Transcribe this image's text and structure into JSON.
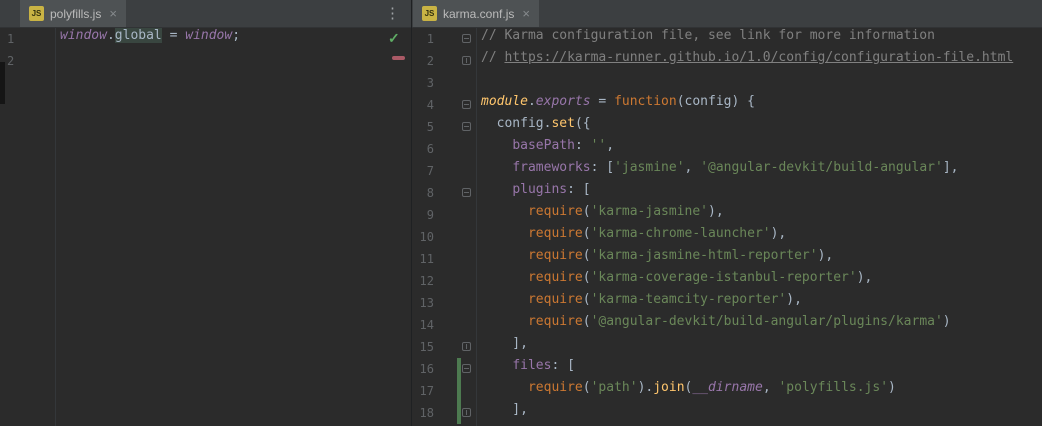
{
  "colors": {
    "background": "#2b2b2b",
    "tab_bar": "#3c3f41",
    "tab_active": "#4e5254",
    "line_number": "#606366",
    "plain_text": "#a9b7c6",
    "comment": "#808080",
    "keyword": "#cc7832",
    "string": "#6a8759",
    "function_call": "#ffc66d",
    "field": "#9876aa",
    "vcs_added_bar": "#4d7a50",
    "modified_marker": "#aa5a66",
    "inspection_ok": "#5fad65"
  },
  "left_pane": {
    "tab": {
      "icon_text": "JS",
      "label": "polyfills.js",
      "close_glyph": "×"
    },
    "more_icon_glyph": "⋮",
    "ok_glyph": "✓",
    "editor": {
      "lines": [
        {
          "num": "1",
          "seg": [
            {
              "c": "g",
              "t": "window"
            },
            {
              "c": "p",
              "t": "."
            },
            {
              "c": "h",
              "t": "global"
            },
            {
              "c": "p",
              "t": " = "
            },
            {
              "c": "g",
              "t": "window"
            },
            {
              "c": "p",
              "t": ";"
            }
          ]
        },
        {
          "num": "2",
          "seg": []
        }
      ]
    }
  },
  "right_pane": {
    "tab": {
      "icon_text": "JS",
      "label": "karma.conf.js",
      "close_glyph": "×"
    },
    "editor": {
      "lines": [
        {
          "num": "1",
          "fold": "start",
          "seg": [
            {
              "c": "c",
              "t": "// Karma configuration file, see link for more information"
            }
          ]
        },
        {
          "num": "2",
          "fold": "end",
          "seg": [
            {
              "c": "c",
              "t": "// "
            },
            {
              "c": "lk",
              "t": "https://karma-runner.github.io/1.0/config/configuration-file.html"
            }
          ]
        },
        {
          "num": "3",
          "seg": []
        },
        {
          "num": "4",
          "fold": "start",
          "seg": [
            {
              "c": "m",
              "t": "module"
            },
            {
              "c": "p",
              "t": "."
            },
            {
              "c": "ve",
              "t": "exports"
            },
            {
              "c": "p",
              "t": " = "
            },
            {
              "c": "k",
              "t": "function"
            },
            {
              "c": "p",
              "t": "(config) {"
            }
          ]
        },
        {
          "num": "5",
          "fold": "start",
          "seg": [
            {
              "c": "p",
              "t": "  config."
            },
            {
              "c": "f",
              "t": "set"
            },
            {
              "c": "p",
              "t": "({"
            }
          ]
        },
        {
          "num": "6",
          "seg": [
            {
              "c": "p",
              "t": "    "
            },
            {
              "c": "v",
              "t": "basePath"
            },
            {
              "c": "p",
              "t": ": "
            },
            {
              "c": "s",
              "t": "''"
            },
            {
              "c": "p",
              "t": ","
            }
          ]
        },
        {
          "num": "7",
          "seg": [
            {
              "c": "p",
              "t": "    "
            },
            {
              "c": "v",
              "t": "frameworks"
            },
            {
              "c": "p",
              "t": ": ["
            },
            {
              "c": "s",
              "t": "'jasmine'"
            },
            {
              "c": "p",
              "t": ", "
            },
            {
              "c": "s",
              "t": "'@angular-devkit/build-angular'"
            },
            {
              "c": "p",
              "t": "],"
            }
          ]
        },
        {
          "num": "8",
          "fold": "start",
          "seg": [
            {
              "c": "p",
              "t": "    "
            },
            {
              "c": "v",
              "t": "plugins"
            },
            {
              "c": "p",
              "t": ": ["
            }
          ]
        },
        {
          "num": "9",
          "seg": [
            {
              "c": "p",
              "t": "      "
            },
            {
              "c": "k",
              "t": "require"
            },
            {
              "c": "p",
              "t": "("
            },
            {
              "c": "s",
              "t": "'karma-jasmine'"
            },
            {
              "c": "p",
              "t": "),"
            }
          ]
        },
        {
          "num": "10",
          "seg": [
            {
              "c": "p",
              "t": "      "
            },
            {
              "c": "k",
              "t": "require"
            },
            {
              "c": "p",
              "t": "("
            },
            {
              "c": "s",
              "t": "'karma-chrome-launcher'"
            },
            {
              "c": "p",
              "t": "),"
            }
          ]
        },
        {
          "num": "11",
          "seg": [
            {
              "c": "p",
              "t": "      "
            },
            {
              "c": "k",
              "t": "require"
            },
            {
              "c": "p",
              "t": "("
            },
            {
              "c": "s",
              "t": "'karma-jasmine-html-reporter'"
            },
            {
              "c": "p",
              "t": "),"
            }
          ]
        },
        {
          "num": "12",
          "seg": [
            {
              "c": "p",
              "t": "      "
            },
            {
              "c": "k",
              "t": "require"
            },
            {
              "c": "p",
              "t": "("
            },
            {
              "c": "s",
              "t": "'karma-coverage-istanbul-reporter'"
            },
            {
              "c": "p",
              "t": "),"
            }
          ]
        },
        {
          "num": "13",
          "seg": [
            {
              "c": "p",
              "t": "      "
            },
            {
              "c": "k",
              "t": "require"
            },
            {
              "c": "p",
              "t": "("
            },
            {
              "c": "s",
              "t": "'karma-teamcity-reporter'"
            },
            {
              "c": "p",
              "t": "),"
            }
          ]
        },
        {
          "num": "14",
          "seg": [
            {
              "c": "p",
              "t": "      "
            },
            {
              "c": "k",
              "t": "require"
            },
            {
              "c": "p",
              "t": "("
            },
            {
              "c": "s",
              "t": "'@angular-devkit/build-angular/plugins/karma'"
            },
            {
              "c": "p",
              "t": ")"
            }
          ]
        },
        {
          "num": "15",
          "fold": "end",
          "seg": [
            {
              "c": "p",
              "t": "    ],"
            }
          ]
        },
        {
          "num": "16",
          "fold": "start",
          "chg": true,
          "seg": [
            {
              "c": "p",
              "t": "    "
            },
            {
              "c": "v",
              "t": "files"
            },
            {
              "c": "p",
              "t": ": ["
            }
          ]
        },
        {
          "num": "17",
          "chg": true,
          "seg": [
            {
              "c": "p",
              "t": "      "
            },
            {
              "c": "k",
              "t": "require"
            },
            {
              "c": "p",
              "t": "("
            },
            {
              "c": "s",
              "t": "'path'"
            },
            {
              "c": "p",
              "t": ")."
            },
            {
              "c": "f",
              "t": "join"
            },
            {
              "c": "p",
              "t": "("
            },
            {
              "c": "g",
              "t": "__dirname"
            },
            {
              "c": "p",
              "t": ", "
            },
            {
              "c": "s",
              "t": "'polyfills.js'"
            },
            {
              "c": "p",
              "t": ")"
            }
          ]
        },
        {
          "num": "18",
          "fold": "end",
          "chg": true,
          "seg": [
            {
              "c": "p",
              "t": "    ],"
            }
          ]
        }
      ]
    }
  }
}
